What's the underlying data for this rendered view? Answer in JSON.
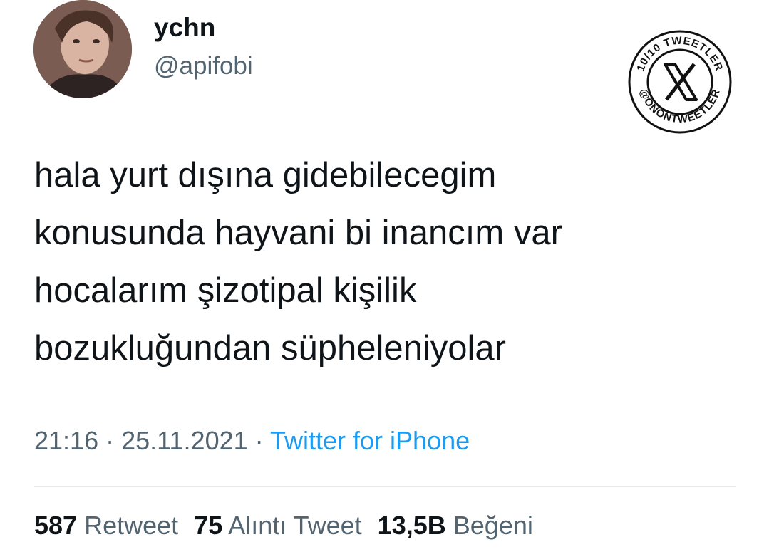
{
  "user": {
    "name": "ychn",
    "handle": "@apifobi"
  },
  "badge": {
    "top_text": "10/10 TWEETLER",
    "bottom_text": "@ONONTWEETLER",
    "logo": "x-logo-icon"
  },
  "tweet": {
    "lines": [
      "hala yurt dışına gidebilecegim",
      "konusunda hayvani bi inancım var",
      "hocalarım şizotipal kişilik",
      "bozukluğundan süpheleniyolar"
    ],
    "time": "21:16",
    "separator": "·",
    "date": "25.11.2021",
    "source": "Twitter for iPhone"
  },
  "stats": {
    "retweets": {
      "count": "587",
      "label": "Retweet"
    },
    "quotes": {
      "count": "75",
      "label": "Alıntı Tweet"
    },
    "likes": {
      "count": "13,5B",
      "label": "Beğeni"
    }
  },
  "colors": {
    "text": "#0f1419",
    "secondary": "#536471",
    "link": "#1d9bf0",
    "divider": "#e6e9ec"
  }
}
